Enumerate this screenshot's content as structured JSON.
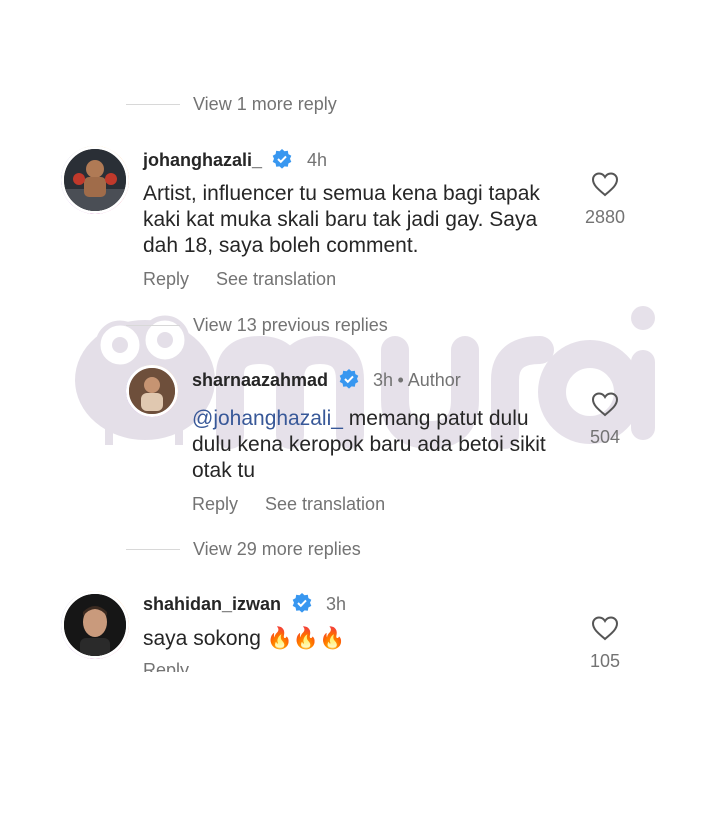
{
  "thread": {
    "view_more_top": "View 1 more reply",
    "comment1": {
      "username": "johanghazali_",
      "time": "4h",
      "text": "Artist, influencer tu semua kena bagi tapak kaki kat muka skali baru tak jadi gay. Saya dah 18, saya boleh comment.",
      "likes": "2880",
      "reply_label": "Reply",
      "translate_label": "See translation"
    },
    "view_previous": "View 13 previous replies",
    "reply1": {
      "username": "sharnaazahmad",
      "time": "3h",
      "author_label": "Author",
      "mention": "@johanghazali_",
      "text": " memang patut dulu dulu kena keropok baru ada betoi sikit otak tu",
      "likes": "504",
      "reply_label": "Reply",
      "translate_label": "See translation"
    },
    "view_more_mid": "View 29 more replies",
    "comment2": {
      "username": "shahidan_izwan",
      "time": "3h",
      "text": "saya sokong 🔥🔥🔥",
      "likes": "105",
      "reply_label": "Reply"
    }
  },
  "watermark": {
    "text": "muroi",
    "color": "#c9bfd0"
  },
  "colors": {
    "verified": "#3897f0",
    "muted": "#737373",
    "mention": "#385898"
  }
}
